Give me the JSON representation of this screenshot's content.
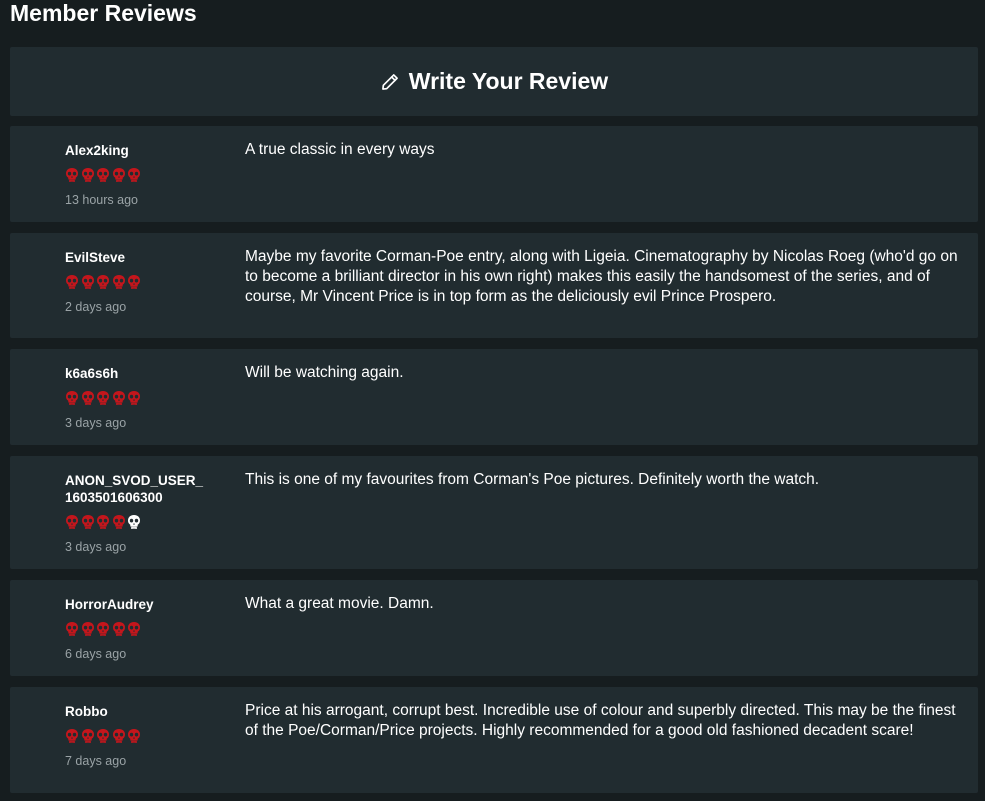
{
  "header": {
    "title": "Member Reviews"
  },
  "write_review": {
    "label": "Write Your Review",
    "icon": "pencil-icon"
  },
  "colors": {
    "background": "#161d1f",
    "card": "#212c30",
    "skull_filled": "#c4161c",
    "skull_empty": "#ffffff",
    "muted": "#9aa3a6"
  },
  "reviews": [
    {
      "user": "Alex2king",
      "rating": 5,
      "time": "13 hours ago",
      "text": "A true classic in every ways"
    },
    {
      "user": "EvilSteve",
      "rating": 5,
      "time": "2 days ago",
      "text": "Maybe my favorite Corman-Poe entry, along with Ligeia. Cinematography by Nicolas Roeg (who'd go on to become a brilliant director in his own right) makes this easily the handsomest of the series, and of course, Mr Vincent Price is in top form as the deliciously evil Prince Prospero."
    },
    {
      "user": "k6a6s6h",
      "rating": 5,
      "time": "3 days ago",
      "text": "Will be watching again."
    },
    {
      "user": "ANON_SVOD_USER_1603501606300",
      "rating": 4,
      "time": "3 days ago",
      "text": "This is one of my favourites from Corman's Poe pictures. Definitely worth the watch."
    },
    {
      "user": "HorrorAudrey",
      "rating": 5,
      "time": "6 days ago",
      "text": "What a great movie. Damn."
    },
    {
      "user": "Robbo",
      "rating": 5,
      "time": "7 days ago",
      "text": "Price at his arrogant, corrupt best. Incredible use of colour and superbly directed. This may be the finest of the Poe/Corman/Price projects. Highly recommended for a good old fashioned decadent scare!"
    }
  ]
}
